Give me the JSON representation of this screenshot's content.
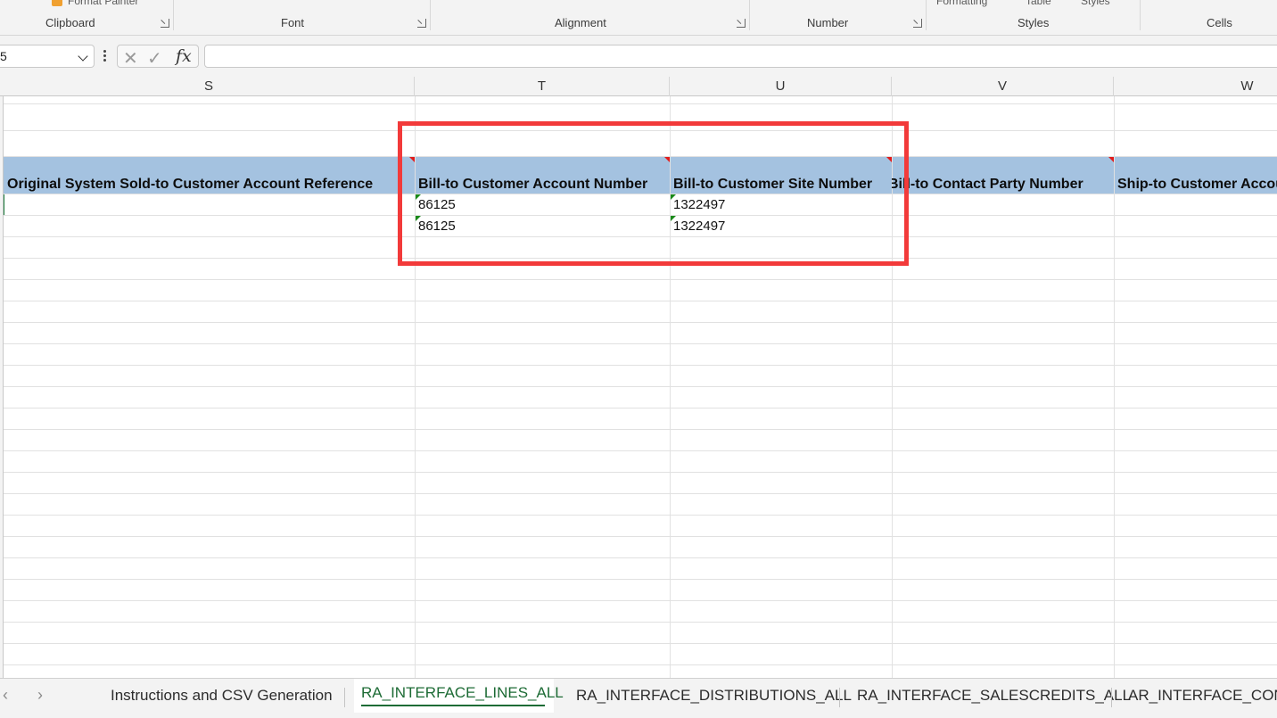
{
  "ribbon": {
    "clipboard_partial_button": "Format Painter",
    "styles_partial_1": "Formatting",
    "styles_partial_2": "Table",
    "styles_partial_3": "Styles",
    "groups": {
      "clipboard": "Clipboard",
      "font": "Font",
      "alignment": "Alignment",
      "number": "Number",
      "styles": "Styles",
      "cells": "Cells"
    }
  },
  "formula_bar": {
    "name_box_value": "5",
    "formula_value": ""
  },
  "columns": [
    "S",
    "T",
    "U",
    "V",
    "W"
  ],
  "header_row": {
    "S": "Original System Sold-to Customer Account Reference",
    "T": "Bill-to Customer Account Number",
    "U": "Bill-to Customer Site Number",
    "V": "Bill-to Contact Party Number",
    "W": "Ship-to Customer Account Number"
  },
  "data_rows": [
    {
      "T": "86125",
      "U": "1322497"
    },
    {
      "T": "86125",
      "U": "1322497"
    }
  ],
  "sheet_tabs": [
    {
      "label": "Instructions and CSV Generation",
      "active": false
    },
    {
      "label": "RA_INTERFACE_LINES_ALL",
      "active": true
    },
    {
      "label": "RA_INTERFACE_DISTRIBUTIONS_ALL",
      "active": false
    },
    {
      "label": "RA_INTERFACE_SALESCREDITS_ALL",
      "active": false
    },
    {
      "label": "AR_INTERFACE_CONTS_ALL",
      "active": false
    }
  ],
  "colors": {
    "header_fill": "#a4c2e0",
    "highlight_box": "#f23a3a",
    "active_tab_accent": "#1d6b35"
  }
}
